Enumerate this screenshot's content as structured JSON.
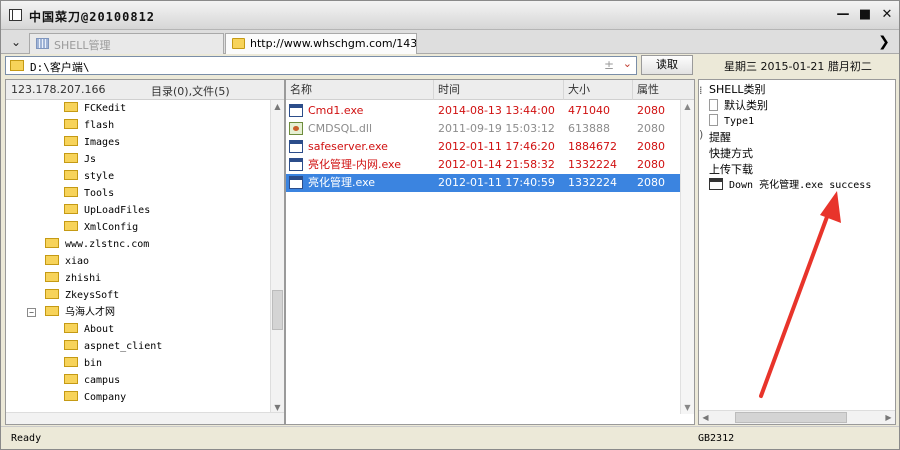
{
  "window": {
    "title": "中国菜刀@20100812",
    "controls": {
      "minimize": "—",
      "maximize": "■",
      "close": "✕"
    }
  },
  "tabs": [
    {
      "label": "SHELL管理",
      "icon": "grid-icon",
      "active": false
    },
    {
      "label": "http://www.whschgm.com/143...",
      "icon": "folder-icon",
      "active": true
    }
  ],
  "tab_nav": {
    "left": "❯",
    "right": "❯"
  },
  "address": {
    "path": "D:\\客户端\\",
    "read_button": "读取",
    "date": "星期三 2015-01-21 腊月初二"
  },
  "left_pane": {
    "ip": "123.178.207.166",
    "summary": "目录(0),文件(5)",
    "tree": [
      {
        "label": "FCKedit"
      },
      {
        "label": "flash"
      },
      {
        "label": "Images"
      },
      {
        "label": "Js"
      },
      {
        "label": "style"
      },
      {
        "label": "Tools"
      },
      {
        "label": "UpLoadFiles"
      },
      {
        "label": "XmlConfig"
      },
      {
        "label": "www.zlstnc.com"
      },
      {
        "label": "xiao"
      },
      {
        "label": "zhishi"
      },
      {
        "label": "ZkeysSoft"
      },
      {
        "label": "乌海人才网",
        "expanded": true
      },
      {
        "label": "About"
      },
      {
        "label": "aspnet_client"
      },
      {
        "label": "bin"
      },
      {
        "label": "campus"
      },
      {
        "label": "Company"
      }
    ]
  },
  "file_list": {
    "columns": [
      "名称",
      "时间",
      "大小",
      "属性"
    ],
    "rows": [
      {
        "name": "Cmd1.exe",
        "time": "2014-08-13 13:44:00",
        "size": "471040",
        "attr": "2080",
        "color": "#d01010",
        "icon": "exe-icon",
        "selected": false
      },
      {
        "name": "CMDSQL.dll",
        "time": "2011-09-19 15:03:12",
        "size": "613888",
        "attr": "2080",
        "color": "#8c8c8c",
        "icon": "dll-icon",
        "selected": false
      },
      {
        "name": "safeserver.exe",
        "time": "2012-01-11 17:46:20",
        "size": "1884672",
        "attr": "2080",
        "color": "#d01010",
        "icon": "exe-icon",
        "selected": false
      },
      {
        "name": "亮化管理-内网.exe",
        "time": "2012-01-14 21:58:32",
        "size": "1332224",
        "attr": "2080",
        "color": "#d01010",
        "icon": "exe-icon",
        "selected": false
      },
      {
        "name": "亮化管理.exe",
        "time": "2012-01-11 17:40:59",
        "size": "1332224",
        "attr": "2080",
        "color": "#ffffff",
        "icon": "exe-icon",
        "selected": true
      }
    ]
  },
  "right_pane": {
    "items": [
      {
        "label": "SHELL类别",
        "icon": ""
      },
      {
        "label": "默认类别",
        "icon": "doc-icon"
      },
      {
        "label": "Type1",
        "icon": "doc-icon"
      },
      {
        "label": "提醒",
        "icon": ""
      },
      {
        "label": "快捷方式",
        "icon": ""
      },
      {
        "label": "上传下载",
        "icon": ""
      },
      {
        "label": "Down 亮化管理.exe success",
        "icon": "window-icon"
      }
    ]
  },
  "status": {
    "text": "Ready",
    "encoding": "GB2312"
  },
  "colors": {
    "selection": "#3b84e0",
    "exe_text": "#d01010",
    "dll_text": "#8c8c8c",
    "arrow": "#e8342b",
    "folder": "#f7d35a"
  }
}
